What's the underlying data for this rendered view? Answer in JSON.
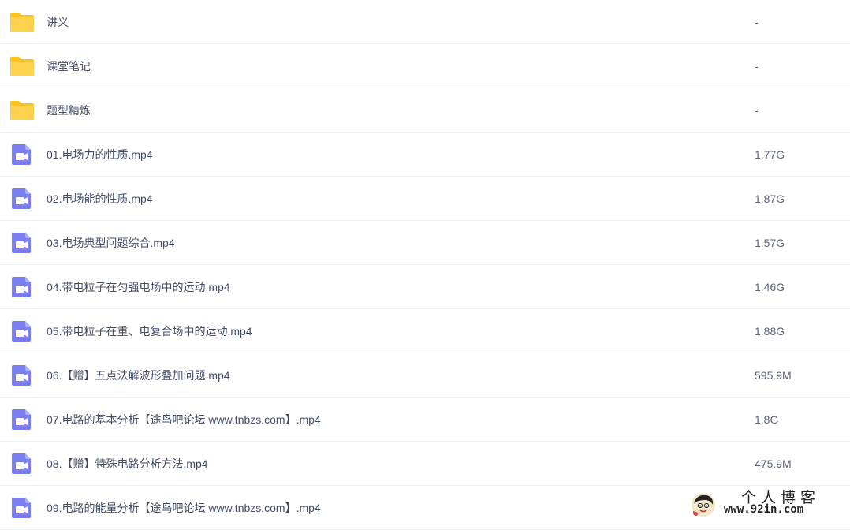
{
  "files": [
    {
      "type": "folder",
      "icon": "folder-icon",
      "name": "讲义",
      "size": "-"
    },
    {
      "type": "folder",
      "icon": "folder-icon",
      "name": "课堂笔记",
      "size": "-"
    },
    {
      "type": "folder",
      "icon": "folder-icon",
      "name": "题型精炼",
      "size": "-"
    },
    {
      "type": "video",
      "icon": "video-file-icon",
      "name": "01.电场力的性质.mp4",
      "size": "1.77G"
    },
    {
      "type": "video",
      "icon": "video-file-icon",
      "name": "02.电场能的性质.mp4",
      "size": "1.87G"
    },
    {
      "type": "video",
      "icon": "video-file-icon",
      "name": "03.电场典型问题综合.mp4",
      "size": "1.57G"
    },
    {
      "type": "video",
      "icon": "video-file-icon",
      "name": "04.带电粒子在匀强电场中的运动.mp4",
      "size": "1.46G"
    },
    {
      "type": "video",
      "icon": "video-file-icon",
      "name": "05.带电粒子在重、电复合场中的运动.mp4",
      "size": "1.88G"
    },
    {
      "type": "video",
      "icon": "video-file-icon",
      "name": "06.【赠】五点法解波形叠加问题.mp4",
      "size": "595.9M"
    },
    {
      "type": "video",
      "icon": "video-file-icon",
      "name": "07.电路的基本分析【途鸟吧论坛 www.tnbzs.com】.mp4",
      "size": "1.8G"
    },
    {
      "type": "video",
      "icon": "video-file-icon",
      "name": "08.【赠】特殊电路分析方法.mp4",
      "size": "475.9M"
    },
    {
      "type": "video",
      "icon": "video-file-icon",
      "name": "09.电路的能量分析【途鸟吧论坛 www.tnbzs.com】.mp4",
      "size": ""
    }
  ],
  "watermark": {
    "title": "个人博客",
    "url": "www.92in.com"
  },
  "colors": {
    "folder": "#ffd24d",
    "folder_tab": "#ffc21a",
    "video": "#7b7ef0",
    "text": "#424e67",
    "divider": "#f1f2f4"
  }
}
